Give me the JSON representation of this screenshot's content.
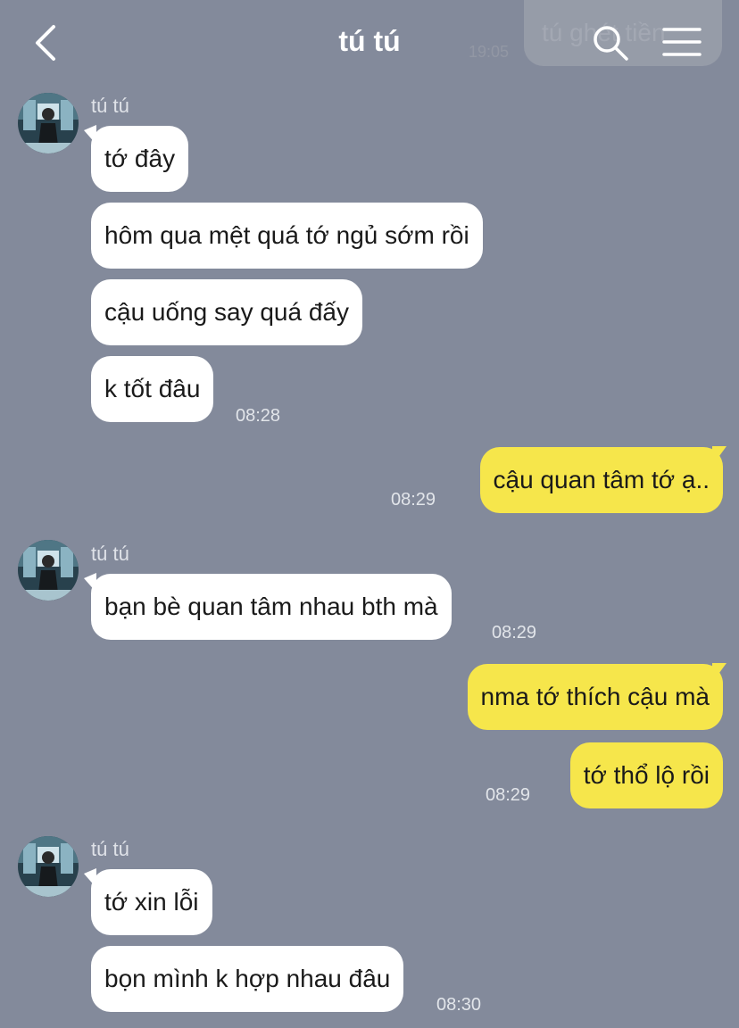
{
  "header": {
    "title": "tú tú",
    "behind_bubble_text": "tú ghét tiền",
    "behind_time": "19:05"
  },
  "contact": {
    "name": "tú tú"
  },
  "groups": [
    {
      "sender": "tú tú",
      "messages": [
        "tớ đây",
        "hôm qua mệt quá tớ ngủ sớm rồi",
        "cậu uống say quá đấy",
        "k tốt đâu"
      ],
      "time": "08:28"
    },
    {
      "me": true,
      "messages": [
        "cậu quan tâm tớ ạ.."
      ],
      "time": "08:29"
    },
    {
      "sender": "tú tú",
      "messages": [
        "bạn bè quan tâm nhau bth mà"
      ],
      "time": "08:29"
    },
    {
      "me": true,
      "messages": [
        "nma tớ thích cậu mà",
        "tớ thổ lộ rồi"
      ],
      "time": "08:29"
    },
    {
      "sender": "tú tú",
      "messages": [
        "tớ xin lỗi",
        "bọn mình k hợp nhau đâu"
      ],
      "time": "08:30"
    }
  ],
  "colors": {
    "background": "#838a9b",
    "incoming_bubble": "#ffffff",
    "outgoing_bubble": "#f6e64b"
  },
  "icons": {
    "back": "chevron-left-icon",
    "search": "search-icon",
    "menu": "hamburger-menu-icon",
    "avatar": "avatar"
  }
}
